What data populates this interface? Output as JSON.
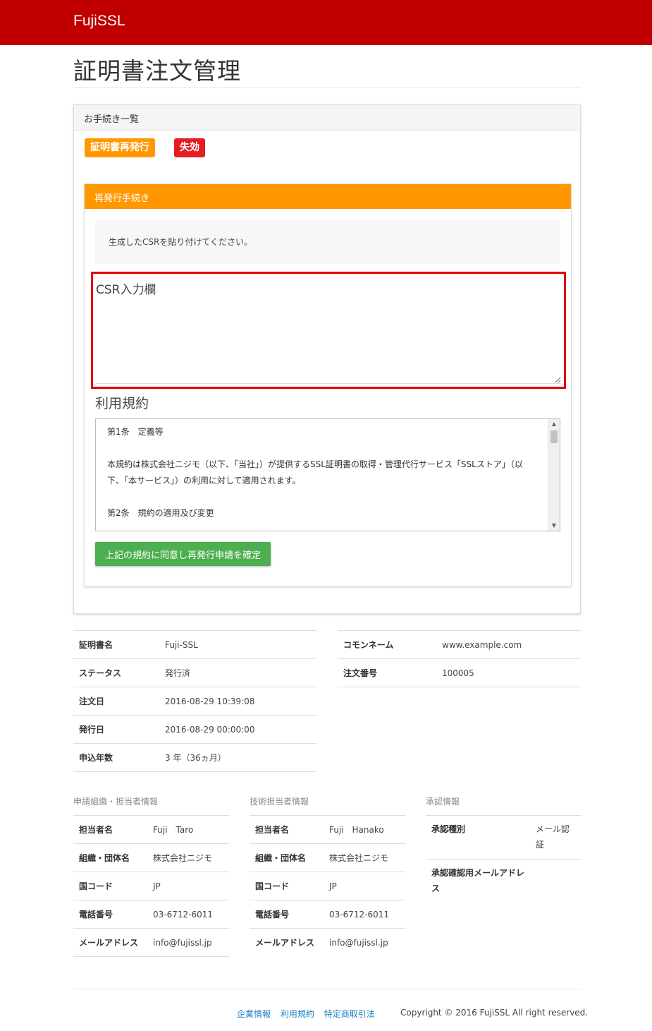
{
  "navbar": {
    "brand": "FujiSSL"
  },
  "page": {
    "title": "証明書注文管理"
  },
  "procedures": {
    "heading": "お手続き一覧",
    "badges": {
      "reissue": "証明書再発行",
      "revoke": "失効"
    }
  },
  "reissue": {
    "heading": "再発行手続き",
    "instruction": "生成したCSRを貼り付けてください。",
    "csr_placeholder": "CSR入力欄",
    "terms_label": "利用規約",
    "terms": [
      "第1条　定義等",
      "本規約は株式会社ニジモ（以下、「当社」）が提供するSSL証明書の取得・管理代行サービス「SSLストア」（以下、「本サービス」）の利用に対して適用されます。",
      "第2条　規約の適用及び変更"
    ],
    "confirm_button": "上記の規約に同意し再発行申請を確定"
  },
  "cert_info_left": [
    {
      "key": "証明書名",
      "value": "Fuji-SSL"
    },
    {
      "key": "ステータス",
      "value": "発行済"
    },
    {
      "key": "注文日",
      "value": "2016-08-29 10:39:08"
    },
    {
      "key": "発行日",
      "value": "2016-08-29 00:00:00"
    },
    {
      "key": "申込年数",
      "value": "3 年（36ヵ月）"
    }
  ],
  "cert_info_right": [
    {
      "key": "コモンネーム",
      "value": "www.example.com"
    },
    {
      "key": "注文番号",
      "value": "100005"
    }
  ],
  "applicant": {
    "label": "申請組織・担当者情報",
    "rows": [
      {
        "key": "担当者名",
        "value": "Fuji　Taro"
      },
      {
        "key": "組織・団体名",
        "value": "株式会社ニジモ"
      },
      {
        "key": "国コード",
        "value": "JP"
      },
      {
        "key": "電話番号",
        "value": "03-6712-6011"
      },
      {
        "key": "メールアドレス",
        "value": "info@fujissl.jp"
      }
    ]
  },
  "technical": {
    "label": "技術担当者情報",
    "rows": [
      {
        "key": "担当者名",
        "value": "Fuji　Hanako"
      },
      {
        "key": "組織・団体名",
        "value": "株式会社ニジモ"
      },
      {
        "key": "国コード",
        "value": "JP"
      },
      {
        "key": "電話番号",
        "value": "03-6712-6011"
      },
      {
        "key": "メールアドレス",
        "value": "info@fujissl.jp"
      }
    ]
  },
  "approval": {
    "label": "承認情報",
    "rows": [
      {
        "key": "承認種別",
        "value": "メール認証"
      },
      {
        "key": "承認確認用メールアドレス",
        "value": ""
      }
    ]
  },
  "footer": {
    "links": [
      "企業情報",
      "利用規約",
      "特定商取引法"
    ],
    "copyright": "Copyright © 2016 FujiSSL All right reserved."
  }
}
